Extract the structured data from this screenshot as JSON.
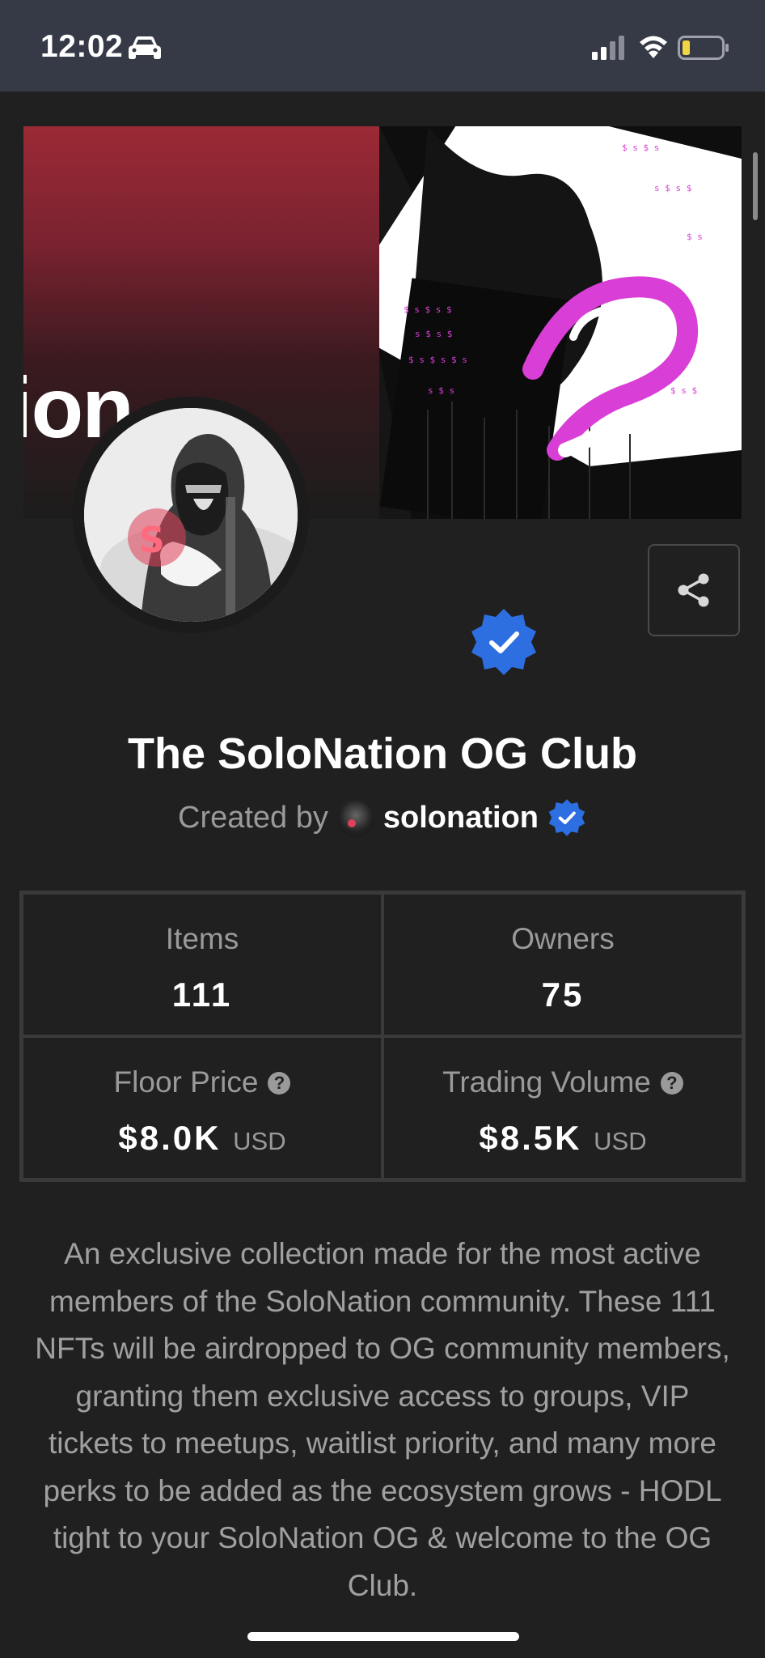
{
  "status_bar": {
    "time": "12:02",
    "icons": [
      "car-icon",
      "signal-icon",
      "wifi-icon",
      "battery-icon"
    ]
  },
  "banner": {
    "text": "ion"
  },
  "collection": {
    "title": "The SoloNation OG Club",
    "created_by_label": "Created by",
    "creator_name": "solonation",
    "verified": true
  },
  "stats": {
    "items": {
      "label": "Items",
      "value": "111"
    },
    "owners": {
      "label": "Owners",
      "value": "75"
    },
    "floor_price": {
      "label": "Floor Price",
      "value": "$8.0K",
      "unit": "USD"
    },
    "trading_volume": {
      "label": "Trading Volume",
      "value": "$8.5K",
      "unit": "USD"
    }
  },
  "description_lines": [
    "An exclusive collection made for the most active",
    "members of the SoloNation community. These 111",
    "NFTs will be airdropped to OG community members,",
    "granting them exclusive access to groups, VIP",
    "tickets to meetups, waitlist priority, and many more",
    "perks to be added as the ecosystem grows - HODL",
    "tight to your SoloNation OG & welcome to the OG",
    "Club."
  ],
  "colors": {
    "background": "#202020",
    "status_bar": "#363a46",
    "verified_blue": "#2d6fe0",
    "accent_magenta": "#d93fd6",
    "accent_red": "#9b2a35"
  }
}
